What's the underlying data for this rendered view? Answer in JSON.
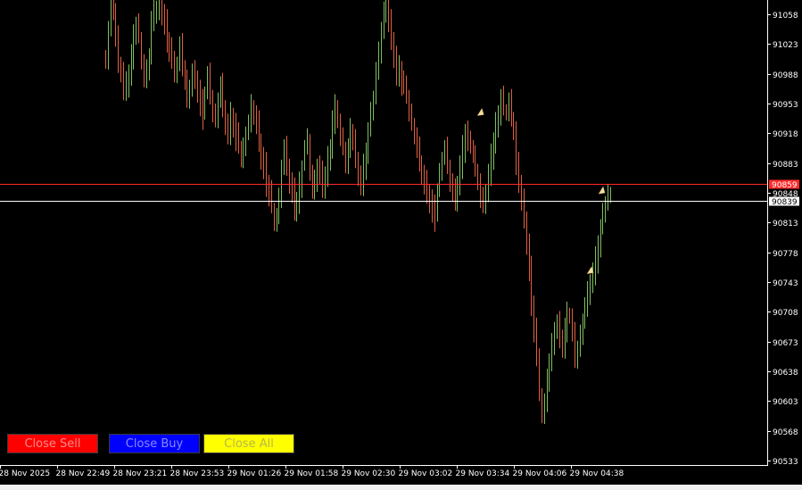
{
  "buttons": {
    "close_sell": "Close Sell",
    "close_buy": "Close Buy",
    "close_all": "Close All",
    "colors": {
      "sell": "#ff0000",
      "buy": "#0000ff",
      "all": "#ffff00"
    }
  },
  "chart_data": {
    "type": "line",
    "style": "candlestick-bars",
    "colors": {
      "bull": "#7fbf5f",
      "bear": "#e06040",
      "background": "#000000",
      "ask_line": "#ff2a2a",
      "bid_line": "#ffffff",
      "axis": "#ffffff"
    },
    "ylim": [
      90520,
      91075
    ],
    "y_ticks": [
      91058,
      91023,
      90988,
      90953,
      90918,
      90883,
      90848,
      90813,
      90778,
      90743,
      90708,
      90673,
      90638,
      90603,
      90568,
      90533
    ],
    "x_ticks": [
      "28 Nov 2025",
      "28 Nov 22:49",
      "28 Nov 23:21",
      "28 Nov 23:53",
      "29 Nov 01:26",
      "29 Nov 01:58",
      "29 Nov 02:30",
      "29 Nov 03:02",
      "29 Nov 03:34",
      "29 Nov 04:06",
      "29 Nov 04:38"
    ],
    "ask_price": 90859,
    "ask_label": "90859",
    "bid_price": 90839,
    "bid_label": "90839",
    "series": [
      {
        "values": [
          91000,
          91040,
          91070,
          91060,
          91030,
          91000,
          90990,
          90970,
          90975,
          90990,
          91010,
          91040,
          91045,
          91030,
          91000,
          90980,
          90990,
          91010,
          91050,
          91060,
          91065,
          91070,
          91060,
          91050,
          91030,
          91020,
          91000,
          90985,
          91000,
          91020,
          90995,
          90980,
          90960,
          90975,
          90990,
          90985,
          90970,
          90955,
          90940,
          90965,
          90985,
          90960,
          90940,
          90935,
          90960,
          90975,
          90950,
          90930,
          90920,
          90940,
          90930,
          90915,
          90900,
          90885,
          90900,
          90920,
          90930,
          90950,
          90940,
          90930,
          90910,
          90890,
          90880,
          90860,
          90850,
          90830,
          90810,
          90820,
          90840,
          90880,
          90900,
          90880,
          90860,
          90850,
          90830,
          90840,
          90860,
          90880,
          90900,
          90910,
          90870,
          90850,
          90860,
          90880,
          90870,
          90855,
          90870,
          90890,
          90905,
          90935,
          90950,
          90930,
          90910,
          90900,
          90880,
          90900,
          90920,
          90910,
          90890,
          90870,
          90860,
          90880,
          90900,
          90920,
          90940,
          90960,
          90990,
          91010,
          91040,
          91060,
          91070,
          91050,
          91030,
          91010,
          90990,
          90995,
          90980,
          90970,
          90960,
          90940,
          90930,
          90915,
          90900,
          90885,
          90870,
          90860,
          90850,
          90840,
          90830,
          90820,
          90850,
          90870,
          90890,
          90900,
          90880,
          90860,
          90850,
          90840,
          90860,
          90880,
          90900,
          90920,
          90915,
          90900,
          90890,
          90875,
          90860,
          90840,
          90835,
          90850,
          90870,
          90890,
          90910,
          90930,
          90945,
          90960,
          90945,
          90940,
          90955,
          90935,
          90920,
          90880,
          90860,
          90840,
          90820,
          90790,
          90760,
          90720,
          90690,
          90650,
          90610,
          90585,
          90600,
          90625,
          90650,
          90670,
          90690,
          90695,
          90680,
          90670,
          90690,
          90705,
          90700,
          90680,
          90650,
          90665,
          90680,
          90700,
          90715,
          90730,
          90745,
          90755,
          90770,
          90790,
          90805,
          90820,
          90835,
          90845,
          90849
        ]
      }
    ],
    "markers": [
      {
        "x": 0.627,
        "y": 90943,
        "direction": "up"
      },
      {
        "x": 0.77,
        "y": 90757,
        "direction": "up"
      },
      {
        "x": 0.785,
        "y": 90851,
        "direction": "up"
      }
    ]
  }
}
